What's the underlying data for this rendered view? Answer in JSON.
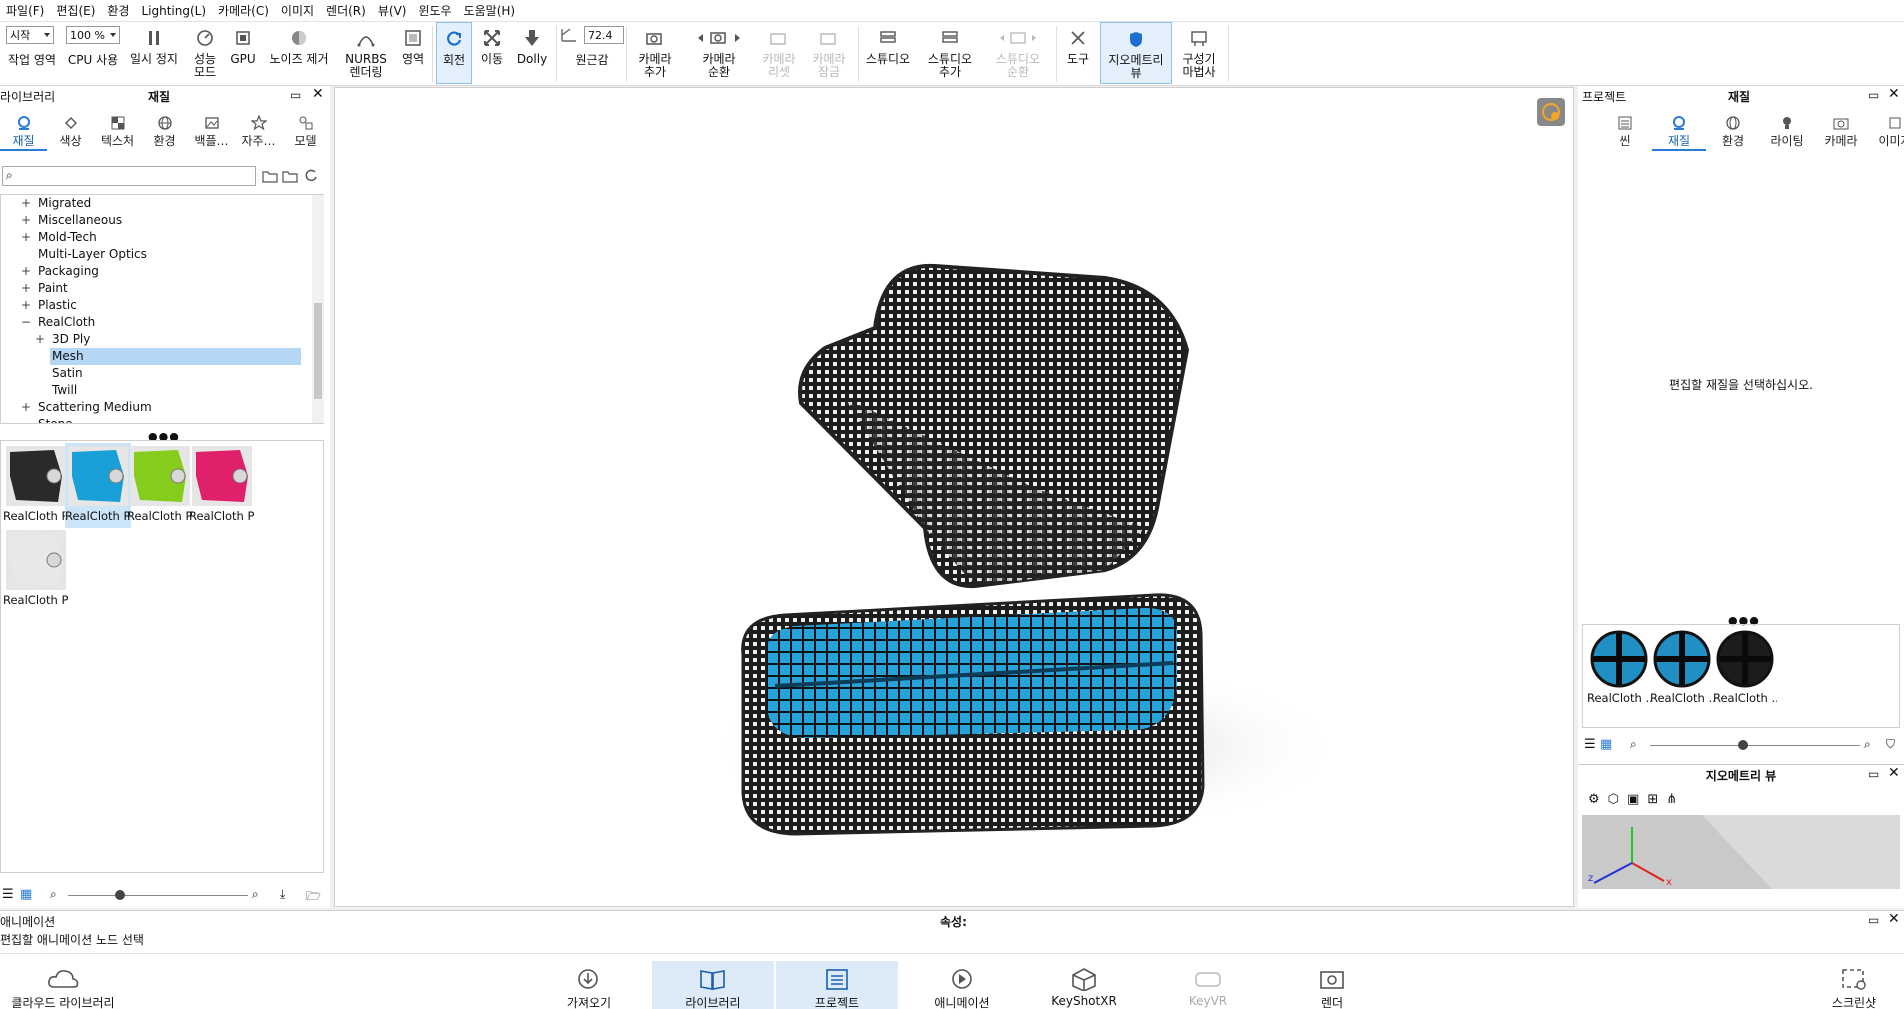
{
  "menu": [
    "파일(F)",
    "편집(E)",
    "환경",
    "Lighting(L)",
    "카메라(C)",
    "이미지",
    "렌더(R)",
    "뷰(V)",
    "윈도우",
    "도움말(H)"
  ],
  "toolbar": {
    "start_combo": "시작",
    "zoom_combo": "100 %",
    "fov_value": "72.4",
    "buttons": [
      "작업 영역",
      "CPU 사용",
      "일시 정지",
      "성능 모드",
      "GPU",
      "노이즈 제거",
      "NURBS 렌더링",
      "영역",
      "회전",
      "이동",
      "Dolly",
      "원근감",
      "카메라 추가",
      "카메라 순환",
      "카메라 리셋",
      "카메라 잠금",
      "스튜디오",
      "스튜디오 추가",
      "스튜디오 순환",
      "도구",
      "지오메트리 뷰",
      "구성기 마법사"
    ]
  },
  "library": {
    "title": "라이브러리",
    "subtitle": "재질",
    "tabs": [
      "재질",
      "색상",
      "텍스처",
      "환경",
      "백플…",
      "자주…",
      "모델"
    ],
    "search_placeholder": "",
    "tree": [
      {
        "label": "Migrated",
        "level": 0,
        "expand": "+"
      },
      {
        "label": "Miscellaneous",
        "level": 0,
        "expand": "+"
      },
      {
        "label": "Mold-Tech",
        "level": 0,
        "expand": "+"
      },
      {
        "label": "Multi-Layer Optics",
        "level": 0,
        "expand": ""
      },
      {
        "label": "Packaging",
        "level": 0,
        "expand": "+"
      },
      {
        "label": "Paint",
        "level": 0,
        "expand": "+"
      },
      {
        "label": "Plastic",
        "level": 0,
        "expand": "+"
      },
      {
        "label": "RealCloth",
        "level": 0,
        "expand": "−"
      },
      {
        "label": "3D Ply",
        "level": 1,
        "expand": "+"
      },
      {
        "label": "Mesh",
        "level": 1,
        "expand": "",
        "selected": true
      },
      {
        "label": "Satin",
        "level": 1,
        "expand": ""
      },
      {
        "label": "Twill",
        "level": 1,
        "expand": ""
      },
      {
        "label": "Scattering Medium",
        "level": 0,
        "expand": "+"
      },
      {
        "label": "Stone",
        "level": 0,
        "expand": ""
      }
    ],
    "thumbs": [
      {
        "label": "RealCloth Pl...",
        "color": "#2a2a2a"
      },
      {
        "label": "RealCloth Pl...",
        "color": "#1aa0d8",
        "selected": true
      },
      {
        "label": "RealCloth Pl...",
        "color": "#86cc1c"
      },
      {
        "label": "RealCloth Pl...",
        "color": "#e0206a"
      },
      {
        "label": "RealCloth Pl...",
        "color": "#e8e8e8"
      }
    ]
  },
  "project": {
    "title": "프로젝트",
    "subtitle": "재질",
    "tabs": [
      "씬",
      "재질",
      "환경",
      "라이팅",
      "카메라",
      "이미지"
    ],
    "placeholder": "편집할 재질을 선택하십시오.",
    "materials": [
      {
        "label": "RealCloth ...",
        "color": "#1f8fc4"
      },
      {
        "label": "RealCloth ...",
        "color": "#1f8fc4"
      },
      {
        "label": "RealCloth ...",
        "color": "#1c1c1c"
      }
    ]
  },
  "geometry": {
    "title": "지오메트리 뷰",
    "axes": {
      "x": "x",
      "z": "z"
    }
  },
  "animation": {
    "title": "애니메이션",
    "properties": "속성:",
    "hint": "편집할 애니메이션 노드 선택",
    "buttons": [
      "클라우드 라이브러리",
      "가져오기",
      "라이브러리",
      "프로젝트",
      "애니메이션",
      "KeyShotXR",
      "KeyVR",
      "렌더",
      "스크린샷"
    ]
  },
  "colors": {
    "accent": "#2a7bd6",
    "selection": "#b5d7f5"
  }
}
